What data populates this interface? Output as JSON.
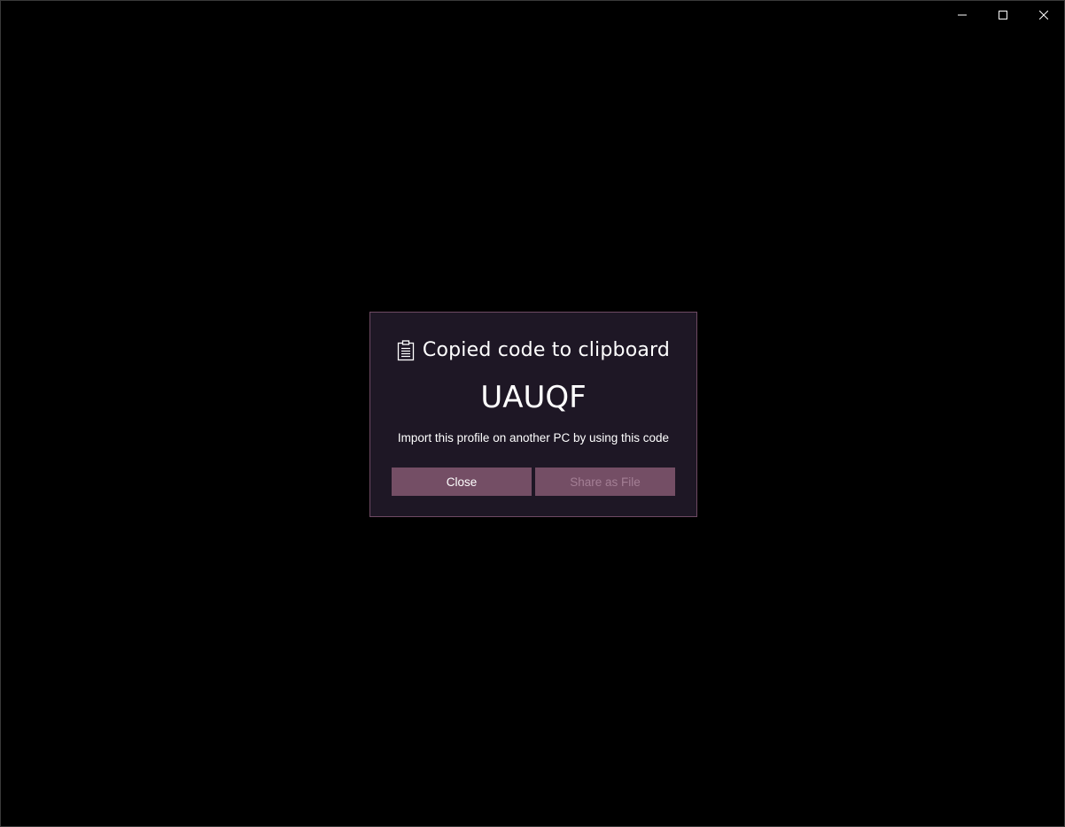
{
  "window": {
    "caption_buttons": [
      {
        "name": "minimize",
        "icon": "minimize-icon"
      },
      {
        "name": "maximize",
        "icon": "maximize-icon"
      },
      {
        "name": "close",
        "icon": "close-icon"
      }
    ]
  },
  "dialog": {
    "icon": "clipboard-icon",
    "title": "Copied code to clipboard",
    "code": "UAUQF",
    "description": "Import this profile on another PC by using this code",
    "buttons": {
      "close_label": "Close",
      "share_label": "Share as File"
    }
  },
  "colors": {
    "background": "#000000",
    "dialog_background": "#1e1725",
    "dialog_border": "#6e4a63",
    "button_background": "#744e65",
    "disabled_text": "#a47f95"
  }
}
